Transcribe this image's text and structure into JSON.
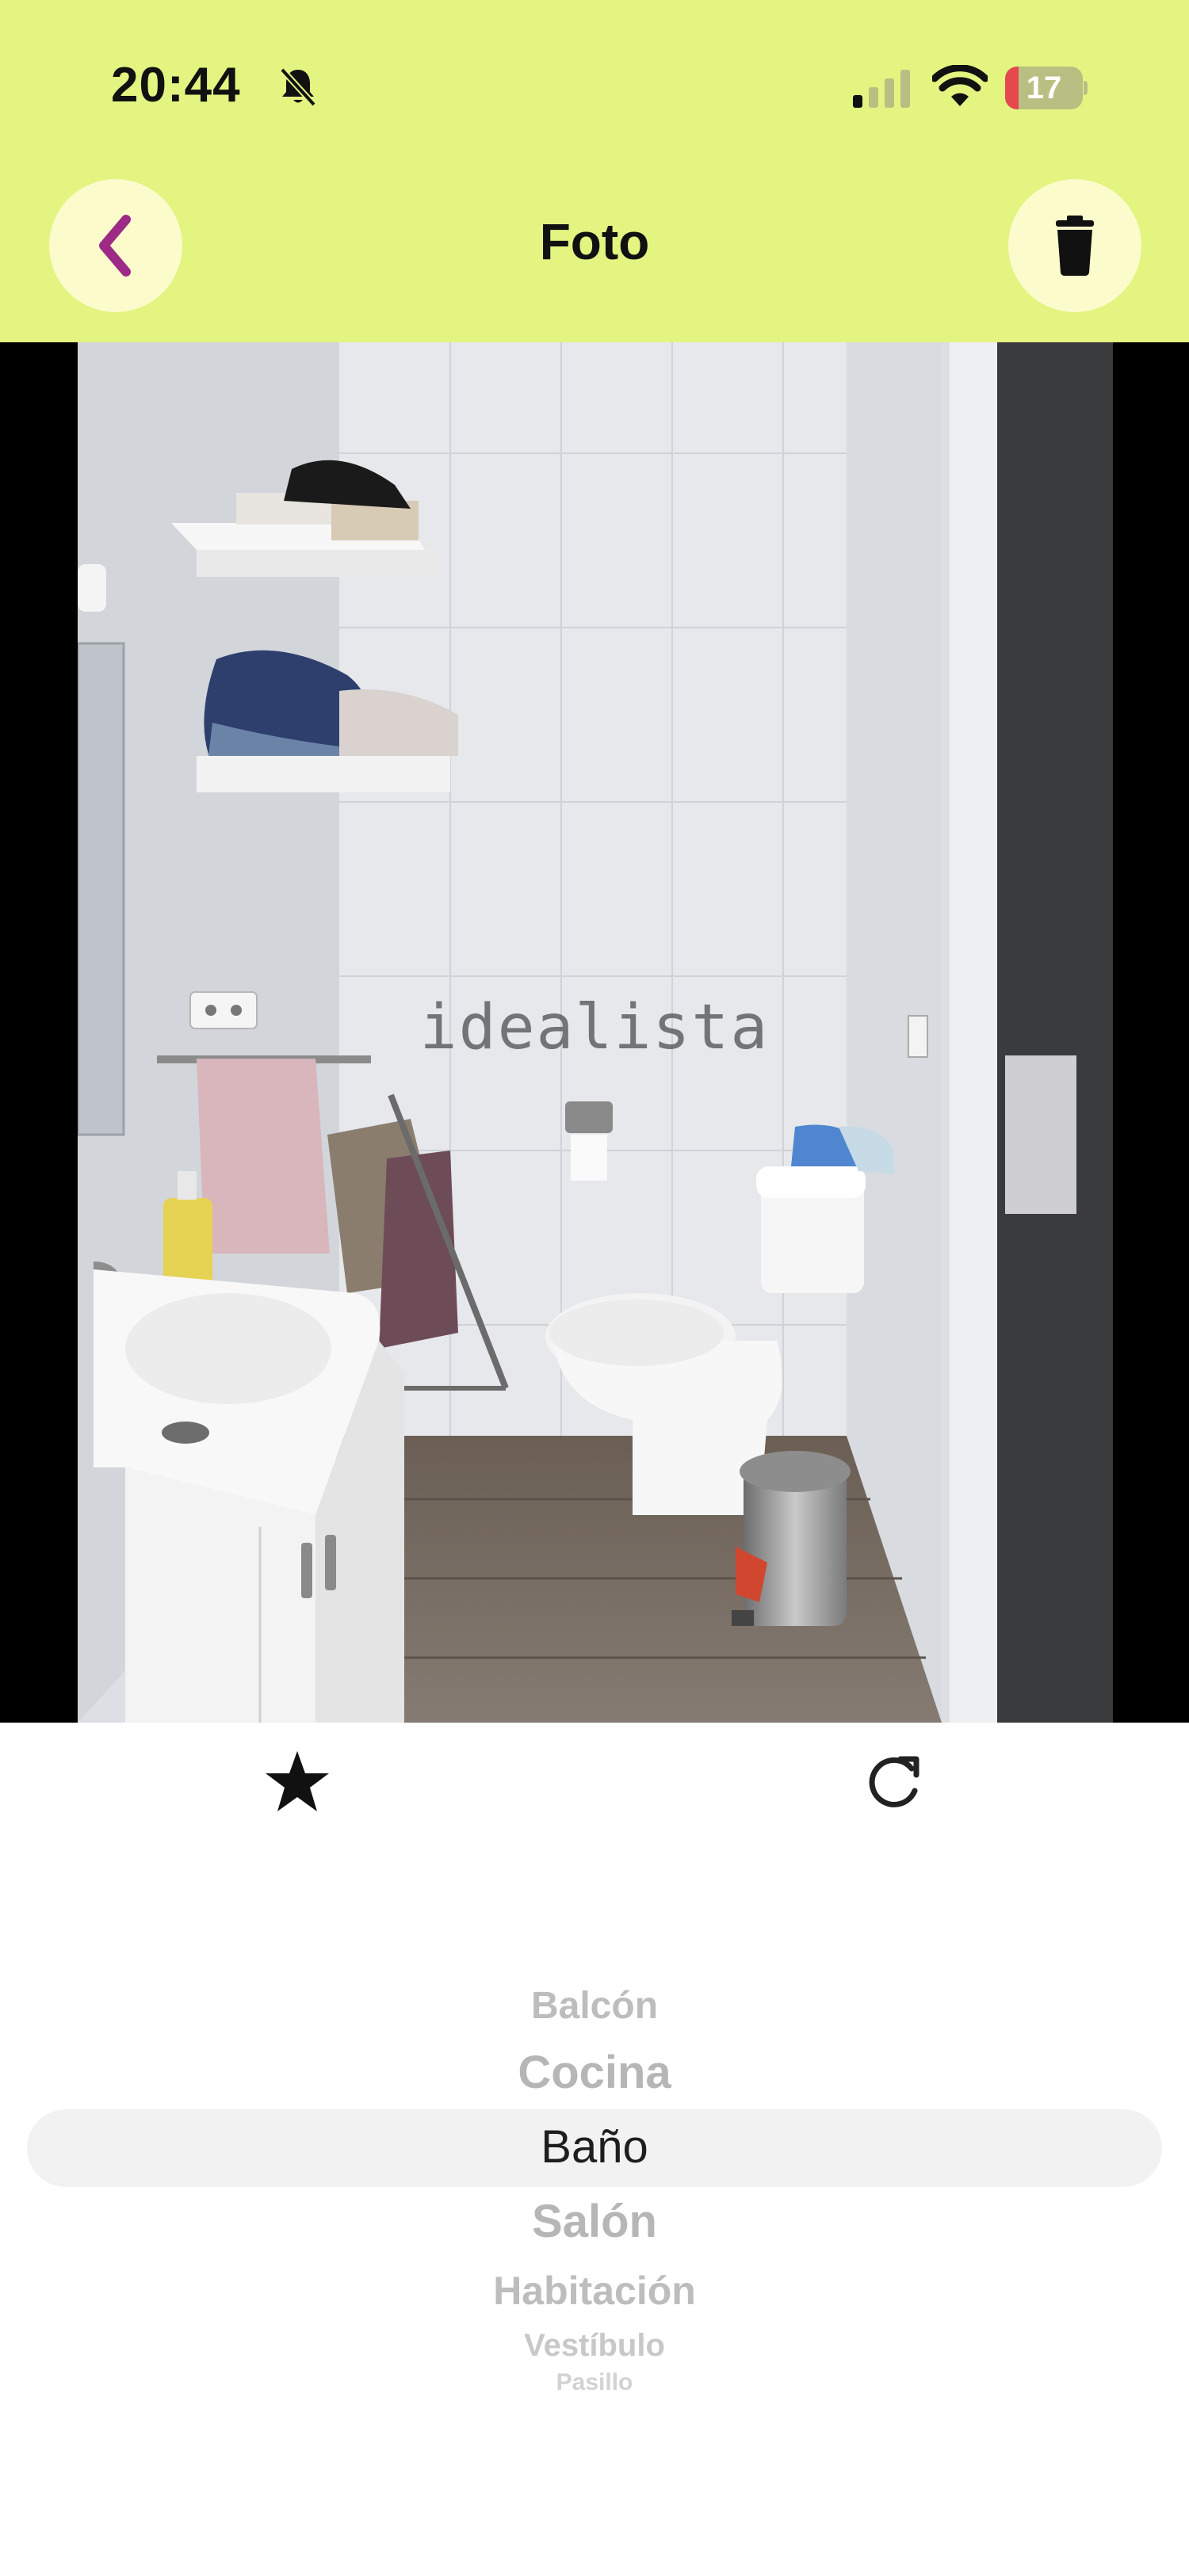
{
  "status_bar": {
    "time": "20:44",
    "battery_level": "17",
    "battery_fraction": 0.17
  },
  "header": {
    "title": "Foto",
    "back_icon": "chevron-left-icon",
    "trash_icon": "trash-icon"
  },
  "photo": {
    "watermark": "idealista"
  },
  "actions": {
    "favorite_icon": "star-icon",
    "rotate_icon": "rotate-icon"
  },
  "room_picker": {
    "selected": "Baño",
    "options": [
      "Balcón",
      "Cocina",
      "Baño",
      "Salón",
      "Habitación",
      "Vestíbulo",
      "Pasillo"
    ]
  },
  "colors": {
    "header_bg": "#e3f481",
    "button_bg": "#fbfbcc",
    "back_arrow": "#9c2a86",
    "battery_low": "#e5484d"
  }
}
